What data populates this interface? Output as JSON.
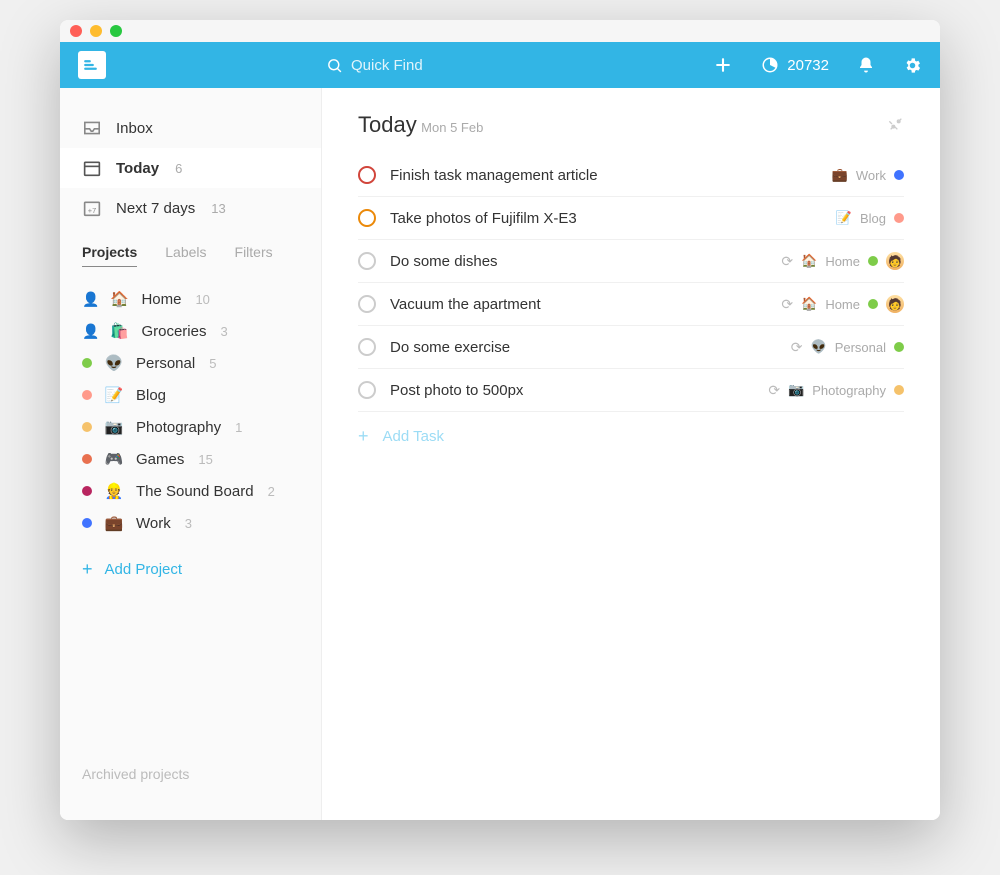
{
  "search_placeholder": "Quick Find",
  "karma_score": "20732",
  "sidebar": {
    "inbox_label": "Inbox",
    "today_label": "Today",
    "today_count": "6",
    "next7_label": "Next 7 days",
    "next7_count": "13",
    "tabs": {
      "projects": "Projects",
      "labels": "Labels",
      "filters": "Filters"
    },
    "add_project": "Add Project",
    "archived": "Archived projects",
    "projects": [
      {
        "color": "#7ecc49",
        "emoji": "🏠",
        "name": "Home",
        "count": "10",
        "shared": true
      },
      {
        "color": "#7ecc49",
        "emoji": "🛍️",
        "name": "Groceries",
        "count": "3",
        "shared": true
      },
      {
        "color": "#7ecc49",
        "emoji": "👽",
        "name": "Personal",
        "count": "5",
        "shared": false
      },
      {
        "color": "#ff9a8b",
        "emoji": "📝",
        "name": "Blog",
        "count": "",
        "shared": false
      },
      {
        "color": "#f5c26b",
        "emoji": "📷",
        "name": "Photography",
        "count": "1",
        "shared": false
      },
      {
        "color": "#e8704f",
        "emoji": "🎮",
        "name": "Games",
        "count": "15",
        "shared": false
      },
      {
        "color": "#b8255f",
        "emoji": "👷",
        "name": "The Sound Board",
        "count": "2",
        "shared": false
      },
      {
        "color": "#4073ff",
        "emoji": "💼",
        "name": "Work",
        "count": "3",
        "shared": false
      }
    ]
  },
  "main": {
    "title": "Today",
    "subtitle": "Mon 5 Feb",
    "add_task": "Add Task",
    "tasks": [
      {
        "priority": "p1",
        "title": "Finish task management article",
        "recur": false,
        "proj_emoji": "💼",
        "proj_name": "Work",
        "proj_color": "#4073ff",
        "assignee": false
      },
      {
        "priority": "p2",
        "title": "Take photos of Fujifilm X-E3",
        "recur": false,
        "proj_emoji": "📝",
        "proj_name": "Blog",
        "proj_color": "#ff9a8b",
        "assignee": false
      },
      {
        "priority": "",
        "title": "Do some dishes",
        "recur": true,
        "proj_emoji": "🏠",
        "proj_name": "Home",
        "proj_color": "#7ecc49",
        "assignee": true
      },
      {
        "priority": "",
        "title": "Vacuum the apartment",
        "recur": true,
        "proj_emoji": "🏠",
        "proj_name": "Home",
        "proj_color": "#7ecc49",
        "assignee": true
      },
      {
        "priority": "",
        "title": "Do some exercise",
        "recur": true,
        "proj_emoji": "👽",
        "proj_name": "Personal",
        "proj_color": "#7ecc49",
        "assignee": false
      },
      {
        "priority": "",
        "title": "Post photo to 500px",
        "recur": true,
        "proj_emoji": "📷",
        "proj_name": "Photography",
        "proj_color": "#f5c26b",
        "assignee": false
      }
    ]
  }
}
